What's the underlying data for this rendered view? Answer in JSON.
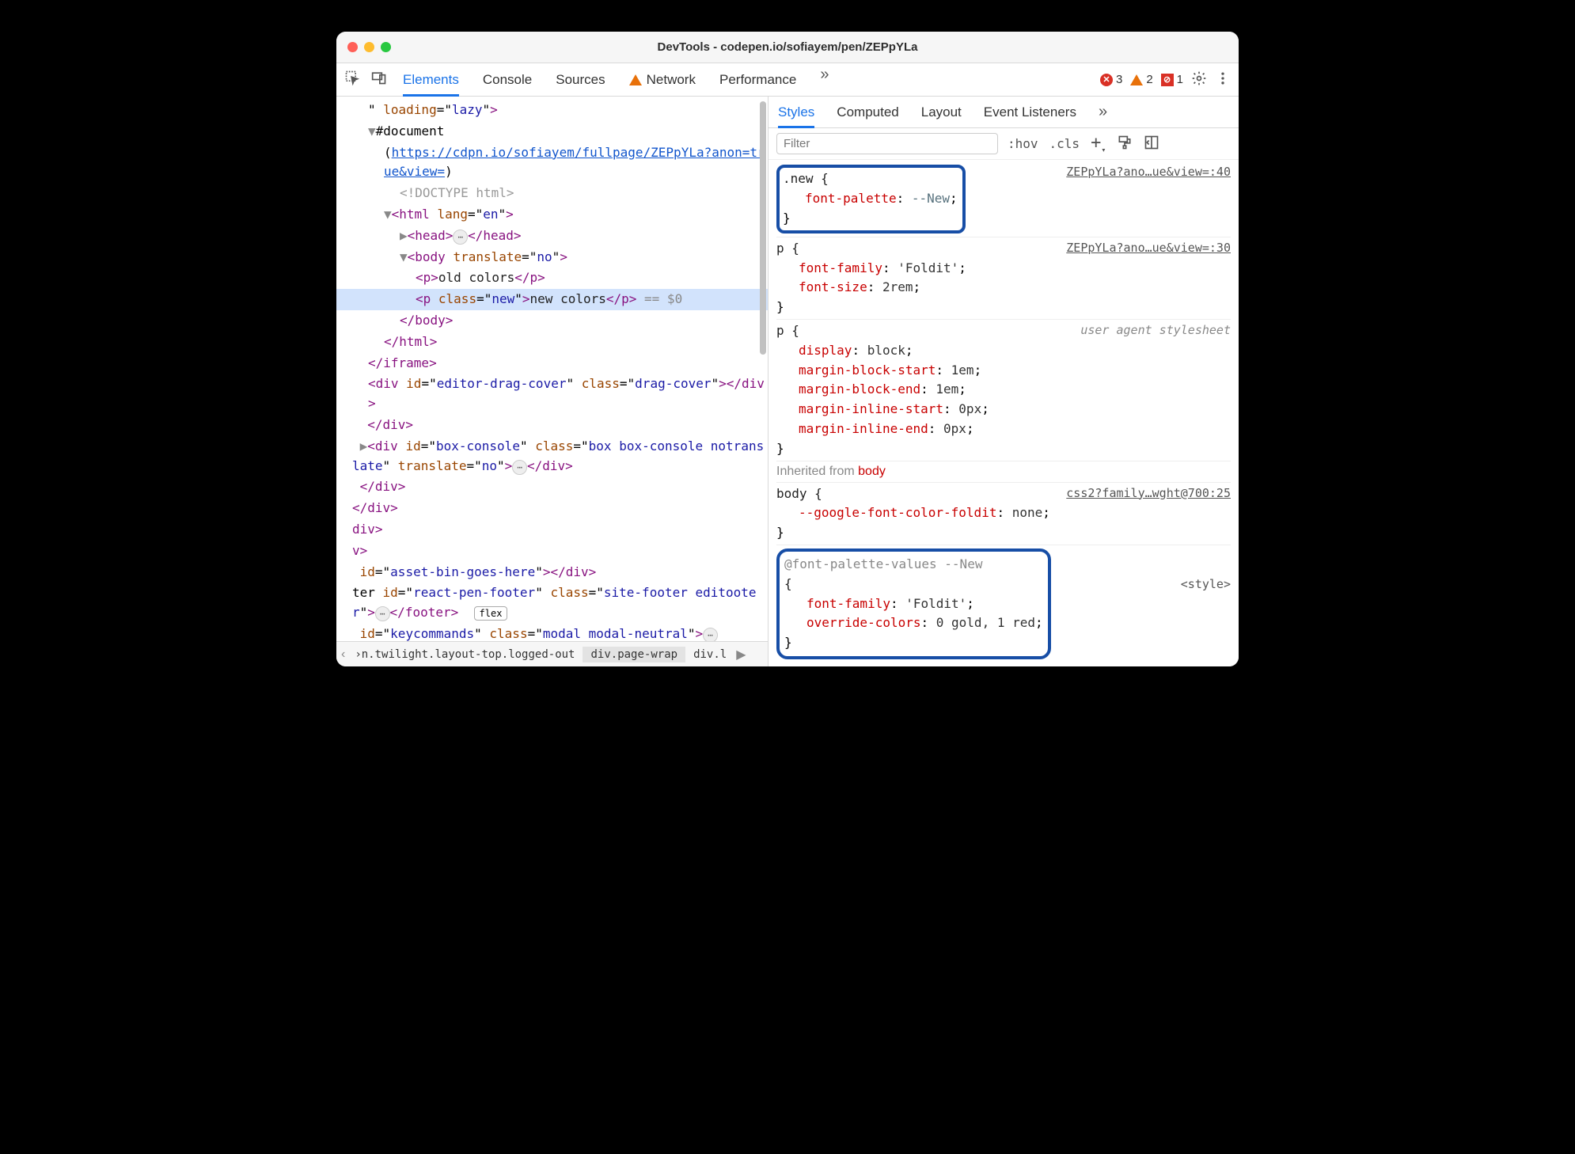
{
  "window": {
    "title": "DevTools - codepen.io/sofiayem/pen/ZEPpYLa"
  },
  "toolbar": {
    "tabs": [
      "Elements",
      "Console",
      "Sources",
      "Network",
      "Performance"
    ],
    "more": "»",
    "errors": "3",
    "warnings": "2",
    "violations": "1"
  },
  "dom": {
    "lines": [
      {
        "indent": 1,
        "raw_html": "\" <span class='attr-n'>loading</span>=\"<span class='attr-v'>lazy</span>\"<span class='tag-brk'>&gt;</span>"
      },
      {
        "indent": 1,
        "raw_html": "<span class='arrow'>▼</span>#document"
      },
      {
        "indent": 2,
        "raw_html": "(<span class='link'>https://cdpn.io/sofiayem/fullpage/ZEPpYLa?anon=true&amp;view=</span>)"
      },
      {
        "indent": 3,
        "raw_html": "<span style='color:#999'>&lt;!DOCTYPE html&gt;</span>"
      },
      {
        "indent": 2,
        "raw_html": "<span class='arrow'>▼</span><span class='tag-brk'>&lt;html </span><span class='attr-n'>lang</span>=\"<span class='attr-v'>en</span>\"<span class='tag-brk'>&gt;</span>"
      },
      {
        "indent": 3,
        "raw_html": "<span class='arrow'>▶</span><span class='tag-brk'>&lt;head&gt;</span><span class='pill'>⋯</span><span class='tag-brk'>&lt;/head&gt;</span>"
      },
      {
        "indent": 3,
        "raw_html": "<span class='arrow'>▼</span><span class='tag-brk'>&lt;body </span><span class='attr-n'>translate</span>=\"<span class='attr-v'>no</span>\"<span class='tag-brk'>&gt;</span>"
      },
      {
        "indent": 4,
        "raw_html": "<span class='tag-brk'>&lt;p&gt;</span><span class='text-n'>old colors</span><span class='tag-brk'>&lt;/p&gt;</span>"
      },
      {
        "indent": 4,
        "sel": true,
        "raw_html": "<span class='tag-brk'>&lt;p </span><span class='attr-n'>class</span>=\"<span class='attr-v'>new</span>\"<span class='tag-brk'>&gt;</span><span class='text-n'>new colors</span><span class='tag-brk'>&lt;/p&gt;</span> <span style='color:#888'>== $0</span>"
      },
      {
        "indent": 3,
        "raw_html": "<span class='tag-brk'>&lt;/body&gt;</span>"
      },
      {
        "indent": 2,
        "raw_html": "<span class='tag-brk'>&lt;/html&gt;</span>"
      },
      {
        "indent": 1,
        "raw_html": "<span class='tag-brk'>&lt;/iframe&gt;</span>"
      },
      {
        "indent": 1,
        "raw_html": "<span class='tag-brk'>&lt;div </span><span class='attr-n'>id</span>=\"<span class='attr-v'>editor-drag-cover</span>\" <span class='attr-n'>class</span>=\"<span class='attr-v'>drag-cover</span>\"<span class='tag-brk'>&gt;&lt;/div&gt;</span>"
      },
      {
        "indent": 0,
        "raw_html": "  <span class='tag-brk'>&lt;/div&gt;</span>"
      },
      {
        "indent": 0,
        "raw_html": " <span class='arrow'>▶</span><span class='tag-brk'>&lt;div </span><span class='attr-n'>id</span>=\"<span class='attr-v'>box-console</span>\" <span class='attr-n'>class</span>=\"<span class='attr-v'>box box-console notranslate</span>\" <span class='attr-n'>translate</span>=\"<span class='attr-v'>no</span>\"<span class='tag-brk'>&gt;</span><span class='pill'>⋯</span><span class='tag-brk'>&lt;/div&gt;</span>"
      },
      {
        "indent": 0,
        "raw_html": " <span class='tag-brk'>&lt;/div&gt;</span>"
      },
      {
        "indent": 0,
        "raw_html": "<span class='tag-brk'>&lt;/div&gt;</span>"
      },
      {
        "indent": -1,
        "raw_html": "<span class='tag-brk'>div&gt;</span>"
      },
      {
        "indent": -1,
        "raw_html": "<span class='tag-brk'>v&gt;</span>"
      },
      {
        "indent": -1,
        "raw_html": " <span class='attr-n'>id</span>=\"<span class='attr-v'>asset-bin-goes-here</span>\"<span class='tag-brk'>&gt;&lt;/div&gt;</span>"
      },
      {
        "indent": -1,
        "raw_html": "ter <span class='attr-n'>id</span>=\"<span class='attr-v'>react-pen-footer</span>\" <span class='attr-n'>class</span>=\"<span class='attr-v'>site-footer editooter</span>\"<span class='tag-brk'>&gt;</span><span class='pill'>⋯</span><span class='tag-brk'>&lt;/footer&gt;</span>  <span class='flex-pill'>flex</span>"
      },
      {
        "indent": -1,
        "raw_html": " <span class='attr-n'>id</span>=\"<span class='attr-v'>keycommands</span>\" <span class='attr-n'>class</span>=\"<span class='attr-v'>modal modal-neutral</span>\"<span class='tag-brk'>&gt;</span><span class='pill'>⋯</span>"
      }
    ]
  },
  "breadcrumbs": {
    "items": [
      "›n.twilight.layout-top.logged-out",
      "div.page-wrap",
      "div.l"
    ],
    "selected": 1,
    "more": "▶"
  },
  "stylesPanel": {
    "tabs": [
      "Styles",
      "Computed",
      "Layout",
      "Event Listeners"
    ],
    "more": "»",
    "filterPlaceholder": "Filter",
    "ops": {
      "hov": ":hov",
      "cls": ".cls",
      "plus": "+"
    }
  },
  "rules": [
    {
      "selector": ".new",
      "hl": true,
      "src": "ZEPpYLa?ano…ue&view=:40",
      "props": [
        {
          "n": "font-palette",
          "v": "--New",
          "var": true
        }
      ]
    },
    {
      "selector": "p",
      "src": "ZEPpYLa?ano…ue&view=:30",
      "props": [
        {
          "n": "font-family",
          "v": "'Foldit'"
        },
        {
          "n": "font-size",
          "v": "2rem"
        }
      ]
    },
    {
      "selector": "p",
      "src": "user agent stylesheet",
      "ua": true,
      "props": [
        {
          "n": "display",
          "v": "block"
        },
        {
          "n": "margin-block-start",
          "v": "1em"
        },
        {
          "n": "margin-block-end",
          "v": "1em"
        },
        {
          "n": "margin-inline-start",
          "v": "0px"
        },
        {
          "n": "margin-inline-end",
          "v": "0px"
        }
      ]
    }
  ],
  "inherited": {
    "label": "Inherited from",
    "from": "body",
    "rule": {
      "selector": "body",
      "src": "css2?family…wght@700:25",
      "props": [
        {
          "n": "--google-font-color-foldit",
          "v": "none"
        }
      ]
    }
  },
  "fontPaletteRule": {
    "header": "@font-palette-values --New",
    "src": "<style>",
    "props": [
      {
        "n": "font-family",
        "v": "'Foldit'"
      },
      {
        "n": "override-colors",
        "v": "0 gold, 1 red"
      }
    ]
  }
}
